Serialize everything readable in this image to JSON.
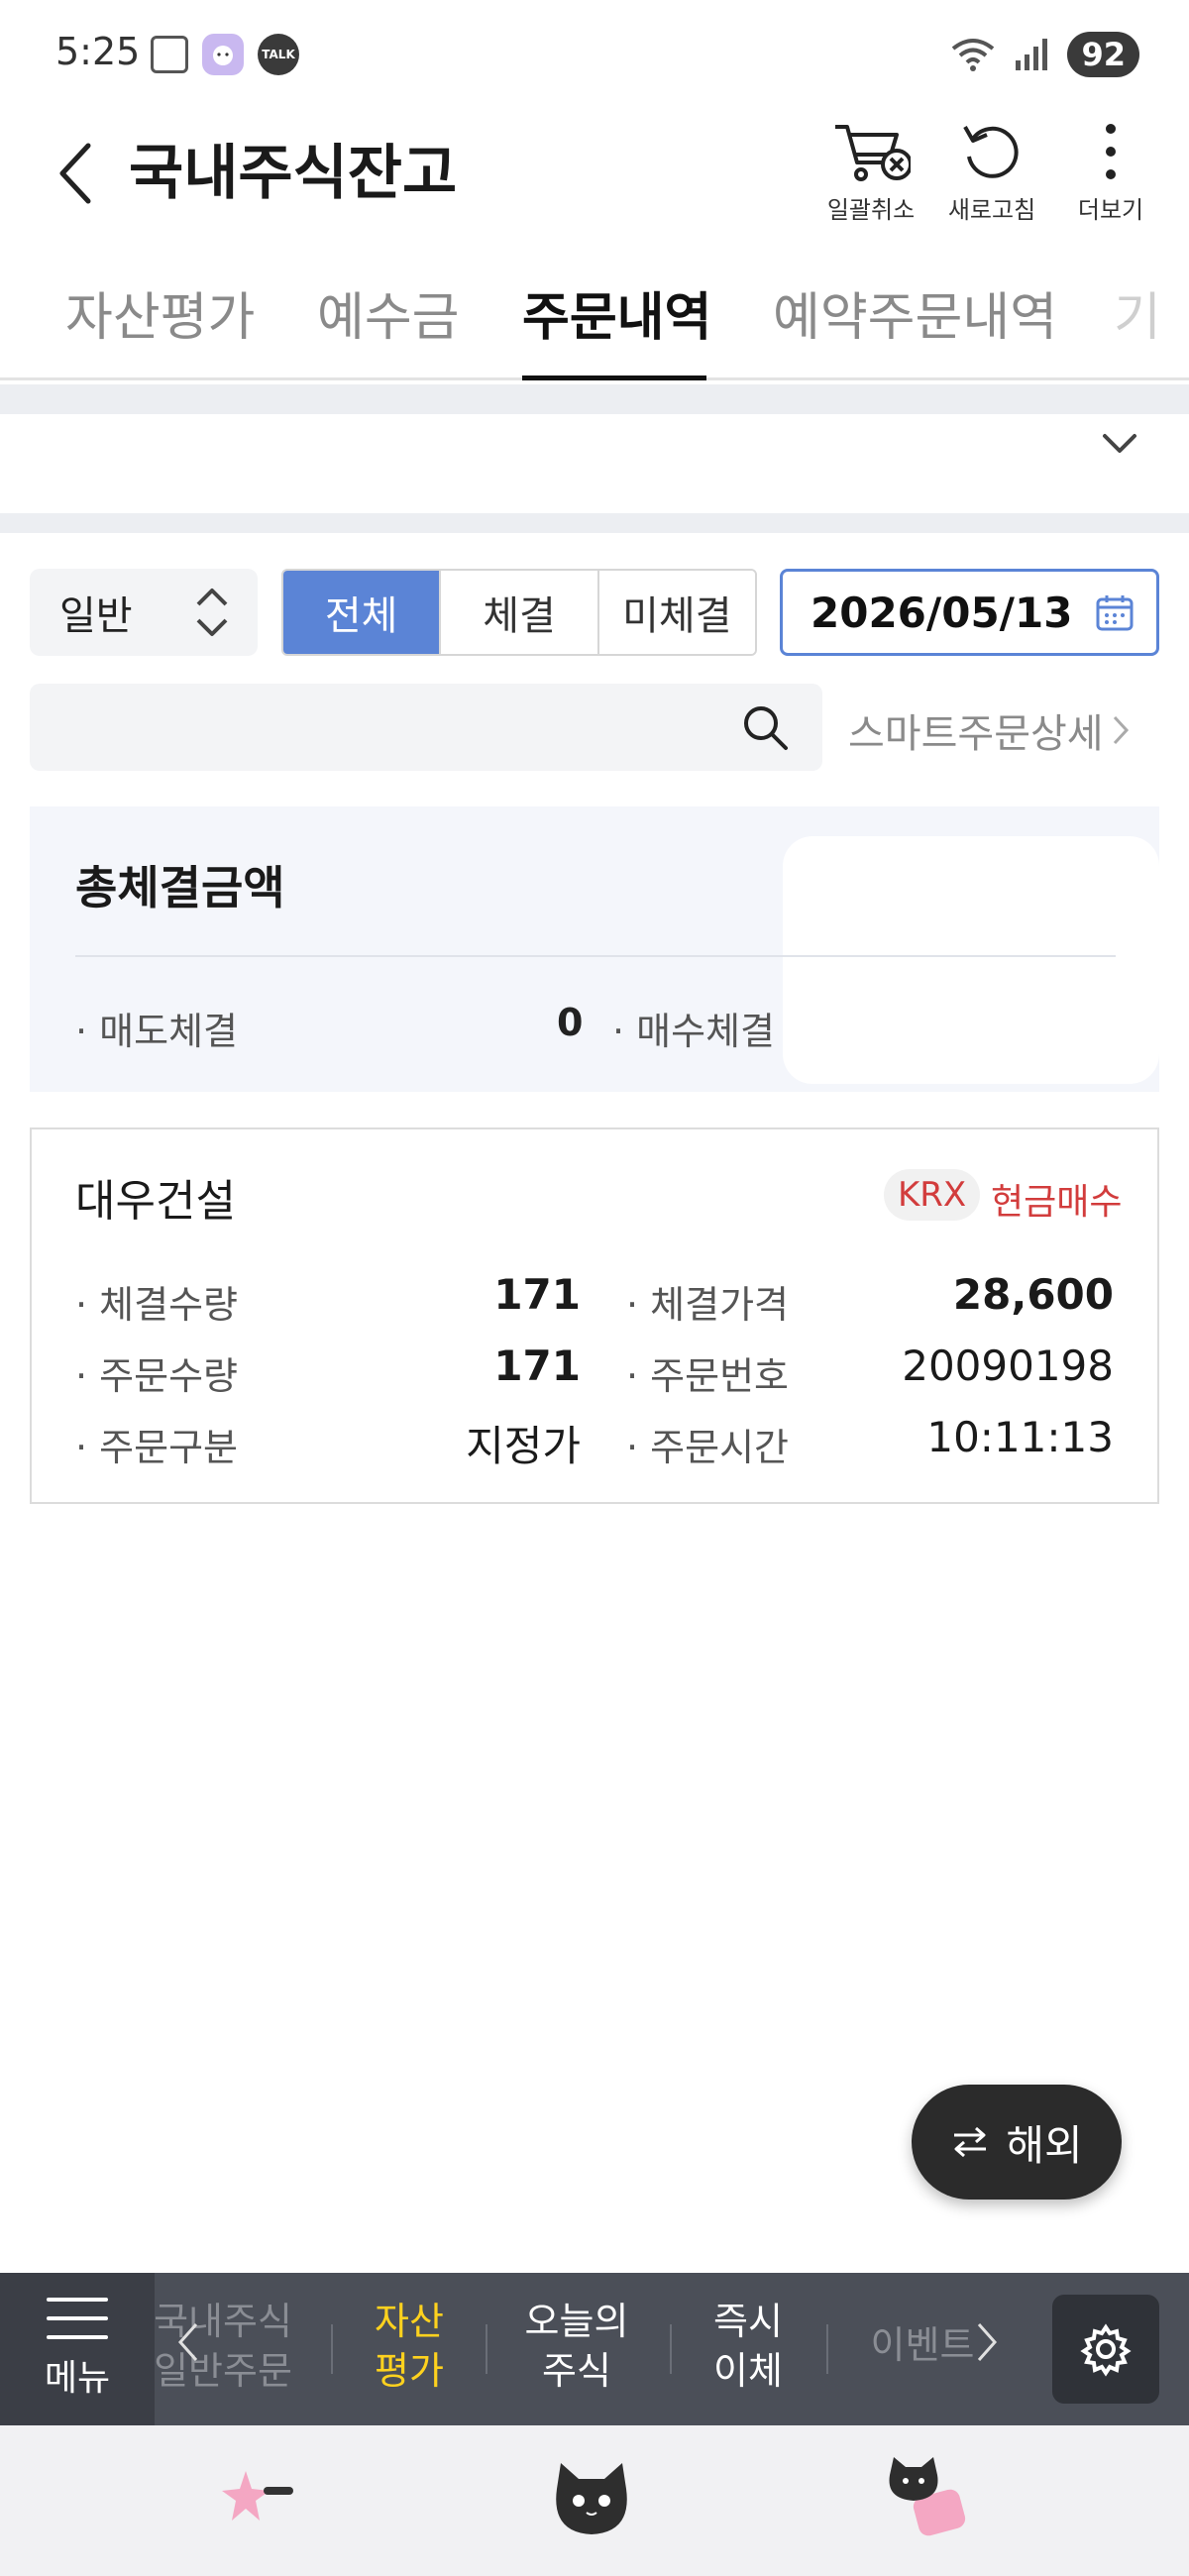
{
  "status_bar": {
    "time": "5:25",
    "talk_label": "TALK",
    "battery": "92"
  },
  "header": {
    "title": "국내주식잔고",
    "actions": [
      {
        "label": "일괄취소",
        "icon": "cart-cancel-icon"
      },
      {
        "label": "새로고침",
        "icon": "refresh-icon"
      },
      {
        "label": "더보기",
        "icon": "more-vertical-icon"
      }
    ]
  },
  "tabs": [
    {
      "label": "자산평가",
      "active": false
    },
    {
      "label": "예수금",
      "active": false
    },
    {
      "label": "주문내역",
      "active": true
    },
    {
      "label": "예약주문내역",
      "active": false
    },
    {
      "label": "기",
      "active": false
    }
  ],
  "filters": {
    "order_type": "일반",
    "segments": [
      {
        "label": "전체",
        "active": true
      },
      {
        "label": "체결",
        "active": false
      },
      {
        "label": "미체결",
        "active": false
      }
    ],
    "date": "2026/05/13"
  },
  "search": {
    "placeholder": "",
    "smart_order_link": "스마트주문상세"
  },
  "summary": {
    "title": "총체결금액",
    "sell_label": "매도체결",
    "sell_value": "0",
    "buy_label": "매수체결"
  },
  "order": {
    "stock_name": "대우건설",
    "market": "KRX",
    "order_type": "현금매수",
    "fields": {
      "filled_qty_label": "체결수량",
      "filled_qty": "171",
      "filled_price_label": "체결가격",
      "filled_price": "28,600",
      "order_qty_label": "주문수량",
      "order_qty": "171",
      "order_no_label": "주문번호",
      "order_no": "20090198",
      "order_kind_label": "주문구분",
      "order_kind": "지정가",
      "order_time_label": "주문시간",
      "order_time": "10:11:13"
    }
  },
  "fab": {
    "label": "해외"
  },
  "bottom_nav": {
    "menu_label": "메뉴",
    "items": [
      {
        "label": "국내주식\n일반주문",
        "state": "faded"
      },
      {
        "label": "자산\n평가",
        "state": "active"
      },
      {
        "label": "오늘의\n주식",
        "state": "normal"
      },
      {
        "label": "즉시\n이체",
        "state": "normal"
      },
      {
        "label": "이벤트",
        "state": "faded"
      }
    ]
  },
  "colors": {
    "accent": "#5b84d6",
    "buy_red": "#d23c3c",
    "nav_active": "#ffd21e",
    "nav_bg": "#4b4f58"
  }
}
